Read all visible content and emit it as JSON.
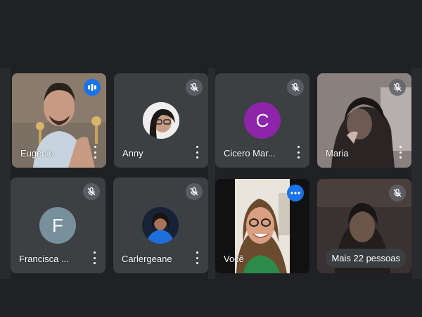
{
  "participants": [
    {
      "name": "Eugenio",
      "status": "speaking",
      "kind": "video"
    },
    {
      "name": "Anny",
      "status": "muted",
      "kind": "photo"
    },
    {
      "name": "Cicero Mar...",
      "status": "muted",
      "kind": "initial",
      "initial": "C",
      "color": "#8e24aa"
    },
    {
      "name": "Maria",
      "status": "muted",
      "kind": "video"
    },
    {
      "name": "Francisca ...",
      "status": "muted",
      "kind": "initial",
      "initial": "F",
      "color": "#78909c"
    },
    {
      "name": "Carlergeane",
      "status": "muted",
      "kind": "photo"
    },
    {
      "name": "Você",
      "status": "speaking",
      "kind": "video"
    },
    {
      "name": "",
      "status": "muted",
      "kind": "video"
    }
  ],
  "overflow": {
    "label": "Mais 22 pessoas"
  },
  "colors": {
    "background": "#202124",
    "tile": "#3c4043",
    "accent": "#1a73e8"
  }
}
